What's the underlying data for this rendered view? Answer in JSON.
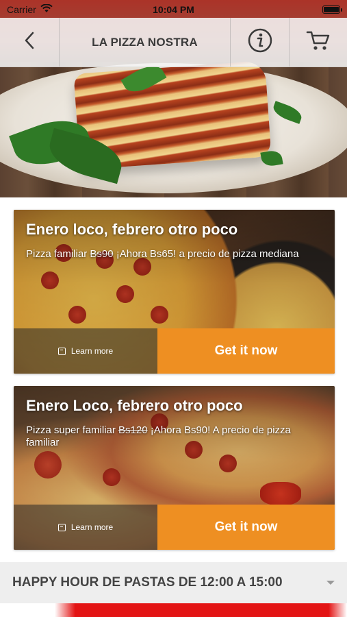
{
  "status_bar": {
    "carrier": "Carrier",
    "time": "10:04 PM"
  },
  "nav": {
    "title": "LA PIZZA NOSTRA",
    "back_icon": "chevron-left-icon",
    "info_icon": "info-icon",
    "cart_icon": "cart-icon"
  },
  "promos": [
    {
      "title": "Enero loco, febrero otro poco",
      "desc_prefix": "Pizza familiar ",
      "desc_strike": "Bs90",
      "desc_suffix": " ¡Ahora Bs65! a precio de pizza mediana",
      "learn_more": "Learn more",
      "cta": "Get it now"
    },
    {
      "title": "Enero Loco, febrero otro poco",
      "desc_prefix": "Pizza super familiar ",
      "desc_strike": "Bs120",
      "desc_suffix": " ¡Ahora Bs90! A precio de pizza familiar",
      "learn_more": "Learn more",
      "cta": "Get it now"
    }
  ],
  "section": {
    "title": "HAPPY HOUR DE PASTAS DE 12:00 A 15:00"
  },
  "colors": {
    "accent": "#ee8f22",
    "nav_bg": "#f5f5f5",
    "section_bg": "#eeeeee"
  }
}
